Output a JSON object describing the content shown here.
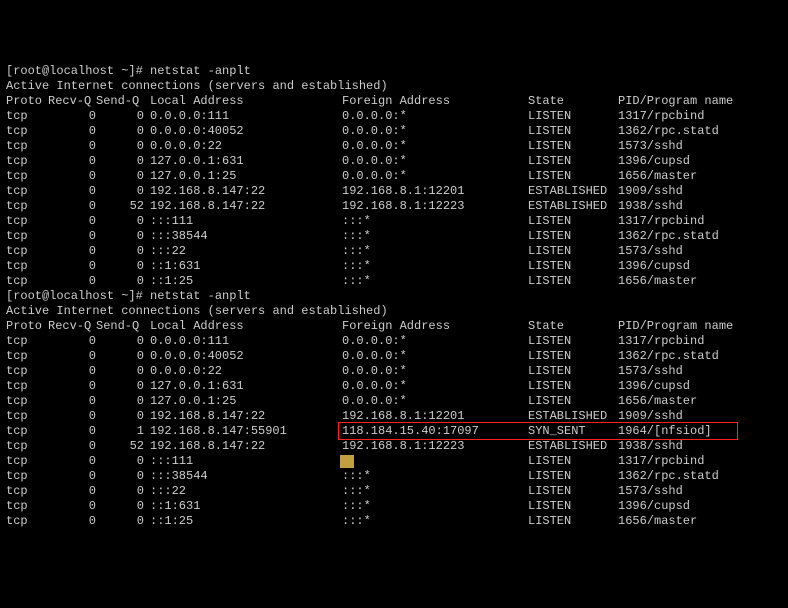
{
  "prompt": "[root@localhost ~]# ",
  "command": "netstat -anplt",
  "header_line": "Active Internet connections (servers and established)",
  "cols": {
    "proto": "Proto",
    "recvq": "Recv-Q",
    "sendq": "Send-Q",
    "local": "Local Address",
    "foreign": "Foreign Address",
    "state": "State",
    "pid": "PID/Program name"
  },
  "set1": [
    {
      "proto": "tcp",
      "recvq": "0",
      "sendq": "0",
      "local": "0.0.0.0:111",
      "foreign": "0.0.0.0:*",
      "state": "LISTEN",
      "pid": "1317/rpcbind"
    },
    {
      "proto": "tcp",
      "recvq": "0",
      "sendq": "0",
      "local": "0.0.0.0:40052",
      "foreign": "0.0.0.0:*",
      "state": "LISTEN",
      "pid": "1362/rpc.statd"
    },
    {
      "proto": "tcp",
      "recvq": "0",
      "sendq": "0",
      "local": "0.0.0.0:22",
      "foreign": "0.0.0.0:*",
      "state": "LISTEN",
      "pid": "1573/sshd"
    },
    {
      "proto": "tcp",
      "recvq": "0",
      "sendq": "0",
      "local": "127.0.0.1:631",
      "foreign": "0.0.0.0:*",
      "state": "LISTEN",
      "pid": "1396/cupsd"
    },
    {
      "proto": "tcp",
      "recvq": "0",
      "sendq": "0",
      "local": "127.0.0.1:25",
      "foreign": "0.0.0.0:*",
      "state": "LISTEN",
      "pid": "1656/master"
    },
    {
      "proto": "tcp",
      "recvq": "0",
      "sendq": "0",
      "local": "192.168.8.147:22",
      "foreign": "192.168.8.1:12201",
      "state": "ESTABLISHED",
      "pid": "1909/sshd"
    },
    {
      "proto": "tcp",
      "recvq": "0",
      "sendq": "52",
      "local": "192.168.8.147:22",
      "foreign": "192.168.8.1:12223",
      "state": "ESTABLISHED",
      "pid": "1938/sshd"
    },
    {
      "proto": "tcp",
      "recvq": "0",
      "sendq": "0",
      "local": ":::111",
      "foreign": ":::*",
      "state": "LISTEN",
      "pid": "1317/rpcbind"
    },
    {
      "proto": "tcp",
      "recvq": "0",
      "sendq": "0",
      "local": ":::38544",
      "foreign": ":::*",
      "state": "LISTEN",
      "pid": "1362/rpc.statd"
    },
    {
      "proto": "tcp",
      "recvq": "0",
      "sendq": "0",
      "local": ":::22",
      "foreign": ":::*",
      "state": "LISTEN",
      "pid": "1573/sshd"
    },
    {
      "proto": "tcp",
      "recvq": "0",
      "sendq": "0",
      "local": "::1:631",
      "foreign": ":::*",
      "state": "LISTEN",
      "pid": "1396/cupsd"
    },
    {
      "proto": "tcp",
      "recvq": "0",
      "sendq": "0",
      "local": "::1:25",
      "foreign": ":::*",
      "state": "LISTEN",
      "pid": "1656/master"
    }
  ],
  "set2": [
    {
      "proto": "tcp",
      "recvq": "0",
      "sendq": "0",
      "local": "0.0.0.0:111",
      "foreign": "0.0.0.0:*",
      "state": "LISTEN",
      "pid": "1317/rpcbind"
    },
    {
      "proto": "tcp",
      "recvq": "0",
      "sendq": "0",
      "local": "0.0.0.0:40052",
      "foreign": "0.0.0.0:*",
      "state": "LISTEN",
      "pid": "1362/rpc.statd"
    },
    {
      "proto": "tcp",
      "recvq": "0",
      "sendq": "0",
      "local": "0.0.0.0:22",
      "foreign": "0.0.0.0:*",
      "state": "LISTEN",
      "pid": "1573/sshd"
    },
    {
      "proto": "tcp",
      "recvq": "0",
      "sendq": "0",
      "local": "127.0.0.1:631",
      "foreign": "0.0.0.0:*",
      "state": "LISTEN",
      "pid": "1396/cupsd"
    },
    {
      "proto": "tcp",
      "recvq": "0",
      "sendq": "0",
      "local": "127.0.0.1:25",
      "foreign": "0.0.0.0:*",
      "state": "LISTEN",
      "pid": "1656/master"
    },
    {
      "proto": "tcp",
      "recvq": "0",
      "sendq": "0",
      "local": "192.168.8.147:22",
      "foreign": "192.168.8.1:12201",
      "state": "ESTABLISHED",
      "pid": "1909/sshd"
    },
    {
      "proto": "tcp",
      "recvq": "0",
      "sendq": "1",
      "local": "192.168.8.147:55901",
      "foreign": "118.184.15.40:17097",
      "state": "SYN_SENT",
      "pid": "1964/[nfsiod]",
      "highlight": true
    },
    {
      "proto": "tcp",
      "recvq": "0",
      "sendq": "52",
      "local": "192.168.8.147:22",
      "foreign": "192.168.8.1:12223",
      "state": "ESTABLISHED",
      "pid": "1938/sshd"
    },
    {
      "proto": "tcp",
      "recvq": "0",
      "sendq": "0",
      "local": ":::111",
      "foreign": "",
      "state": "LISTEN",
      "pid": "1317/rpcbind",
      "cursor": true
    },
    {
      "proto": "tcp",
      "recvq": "0",
      "sendq": "0",
      "local": ":::38544",
      "foreign": ":::*",
      "state": "LISTEN",
      "pid": "1362/rpc.statd"
    },
    {
      "proto": "tcp",
      "recvq": "0",
      "sendq": "0",
      "local": ":::22",
      "foreign": ":::*",
      "state": "LISTEN",
      "pid": "1573/sshd"
    },
    {
      "proto": "tcp",
      "recvq": "0",
      "sendq": "0",
      "local": "::1:631",
      "foreign": ":::*",
      "state": "LISTEN",
      "pid": "1396/cupsd"
    },
    {
      "proto": "tcp",
      "recvq": "0",
      "sendq": "0",
      "local": "::1:25",
      "foreign": ":::*",
      "state": "LISTEN",
      "pid": "1656/master"
    }
  ]
}
